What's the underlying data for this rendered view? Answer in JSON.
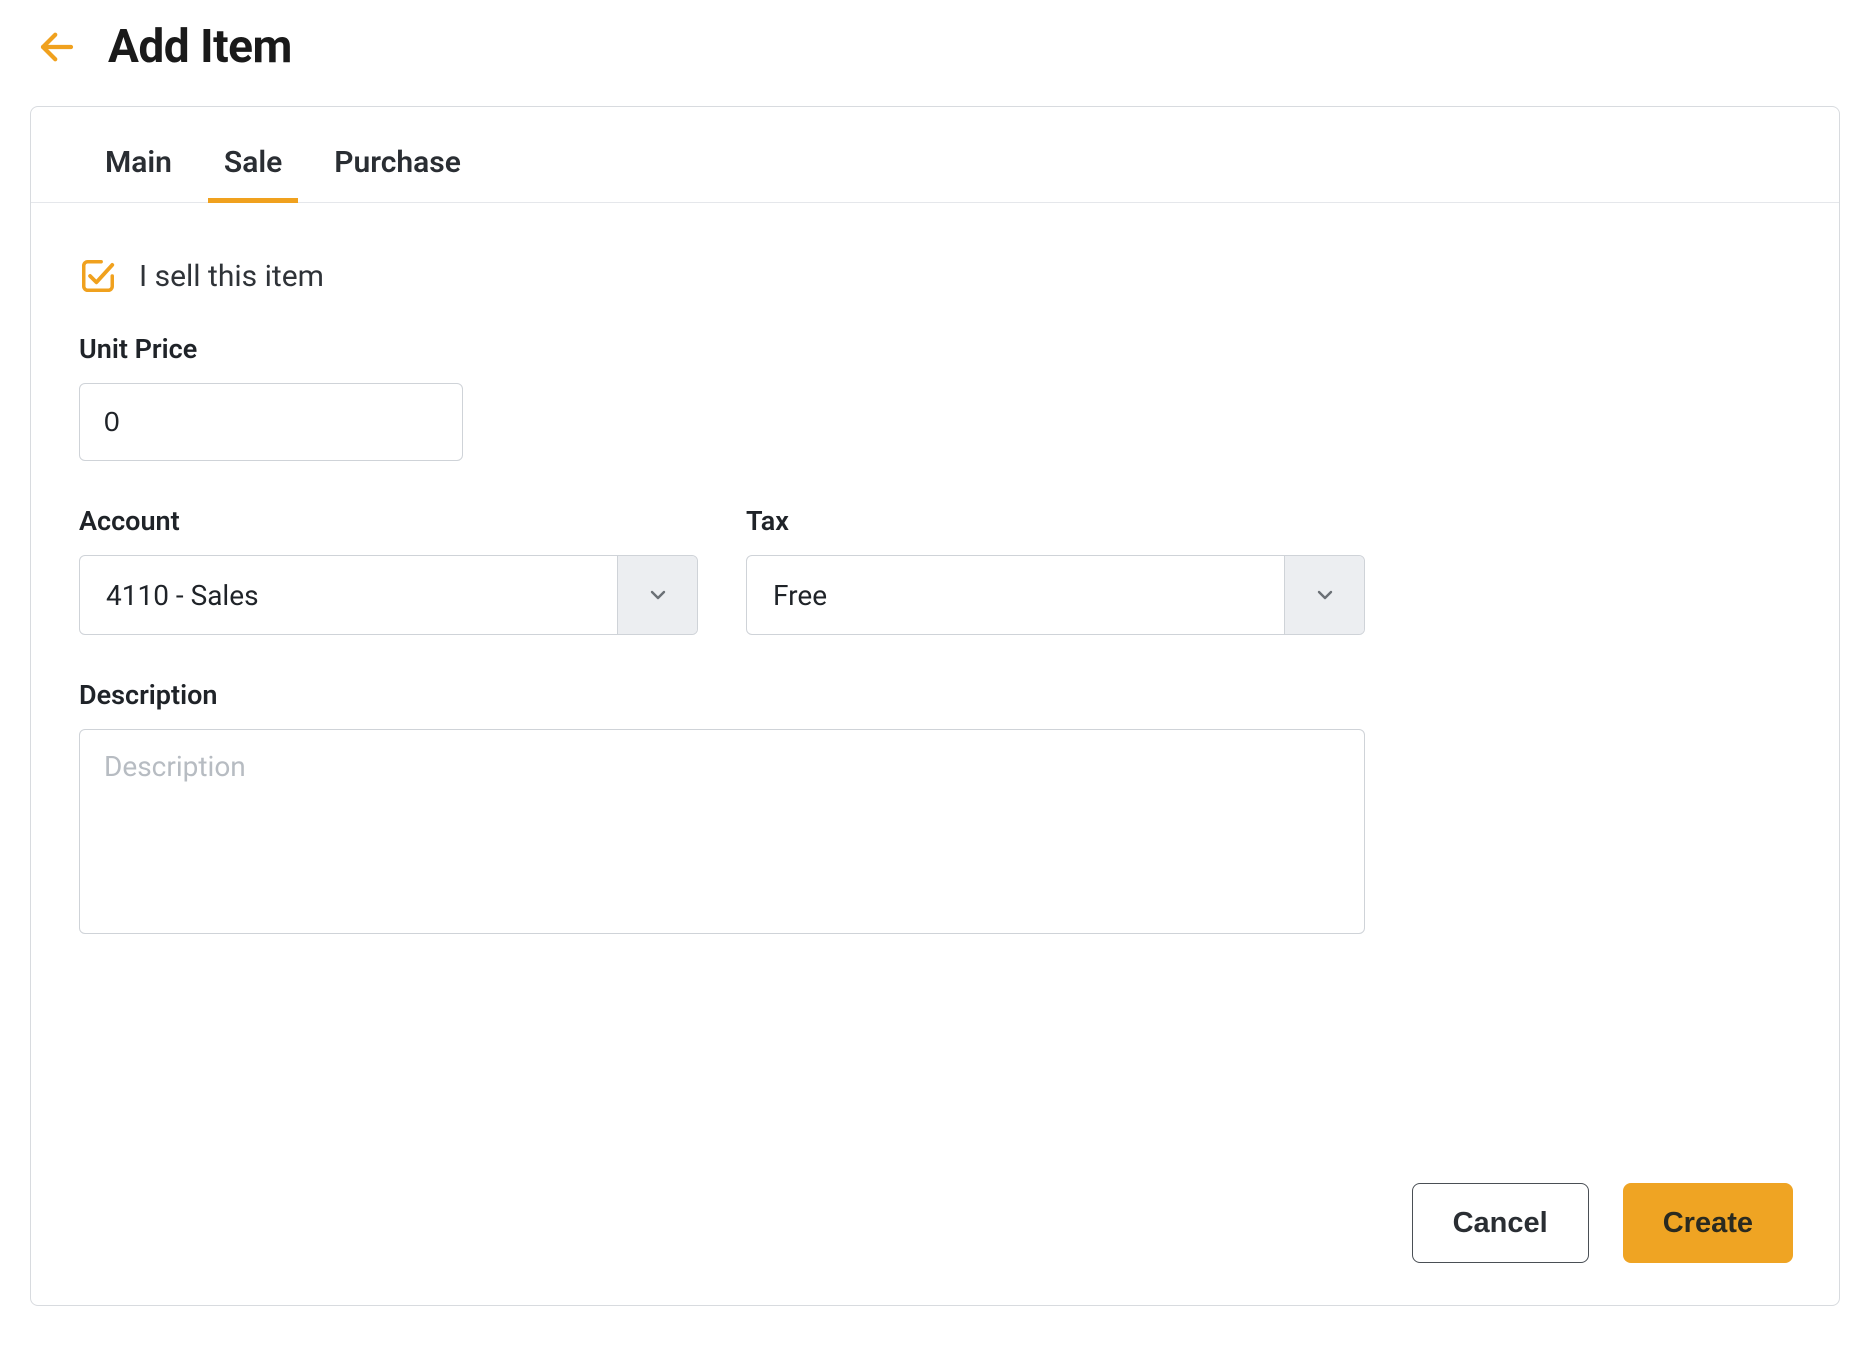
{
  "header": {
    "title": "Add Item"
  },
  "tabs": {
    "main": "Main",
    "sale": "Sale",
    "purchase": "Purchase"
  },
  "form": {
    "sell_checkbox_label": "I sell this item",
    "unit_price": {
      "label": "Unit Price",
      "value": "0"
    },
    "account": {
      "label": "Account",
      "value": "4110 - Sales"
    },
    "tax": {
      "label": "Tax",
      "value": "Free"
    },
    "description": {
      "label": "Description",
      "placeholder": "Description",
      "value": ""
    }
  },
  "footer": {
    "cancel": "Cancel",
    "create": "Create"
  },
  "colors": {
    "accent": "#efa423",
    "border": "#cfd3d8",
    "text": "#1f2328"
  }
}
